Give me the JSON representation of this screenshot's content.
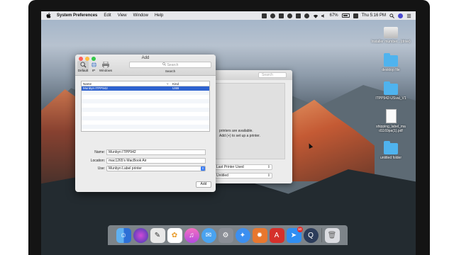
{
  "menubar": {
    "app_name": "System Preferences",
    "items": [
      "Edit",
      "View",
      "Window",
      "Help"
    ],
    "battery": "67%",
    "clock": "Thu 5:16 PM"
  },
  "desktop_icons": [
    {
      "label": "Installer mumber...(drive)",
      "icon": "drive-icon"
    },
    {
      "label": "desktop file",
      "icon": "folder-icon"
    },
    {
      "label": "ITPP942-USval_V1",
      "icon": "folder-icon"
    },
    {
      "label": "shipping_label_ma d1169pa(1).pdf",
      "icon": "document-icon"
    },
    {
      "label": "untitled folder",
      "icon": "folder-icon"
    }
  ],
  "background_window": {
    "search_placeholder": "Search",
    "message_line1": "printers are available.",
    "message_line2": "Add (+) to set up a printer.",
    "select1": "Last Printer Used",
    "select2": "Untitled"
  },
  "add_window": {
    "title": "Add",
    "toolbar": [
      {
        "label": "Default",
        "icon": "default-printer-icon"
      },
      {
        "label": "IP",
        "icon": "globe-icon"
      },
      {
        "label": "Windows",
        "icon": "windows-printer-icon"
      }
    ],
    "search_placeholder": "Search",
    "search_label": "Search",
    "list": {
      "columns": [
        "Name",
        "Kind"
      ],
      "rows": [
        {
          "name": "Munbyn ITPP942",
          "kind": "USB",
          "selected": true
        }
      ]
    },
    "form": {
      "name_label": "Name:",
      "name_value": "Munbyn ITPP942",
      "location_label": "Location:",
      "location_value": "mac1265's MacBook Air",
      "use_label": "Use:",
      "use_value": "Munbyn Label printer"
    },
    "add_button": "Add"
  },
  "dock": {
    "items": [
      "finder-icon",
      "siri-icon",
      "launchpad-icon",
      "notes-icon",
      "photos-icon",
      "itunes-icon",
      "messages-icon",
      "system-preferences-icon",
      "safari-icon",
      "settings-app-icon",
      "acrobat-icon",
      "airmail-icon",
      "quicktime-icon",
      "trash-icon"
    ],
    "airmail_badge": "10"
  },
  "colors": {
    "selection": "#2e62cf",
    "close": "#fc605b",
    "minimize": "#fdbc40",
    "zoom": "#34c84a"
  }
}
